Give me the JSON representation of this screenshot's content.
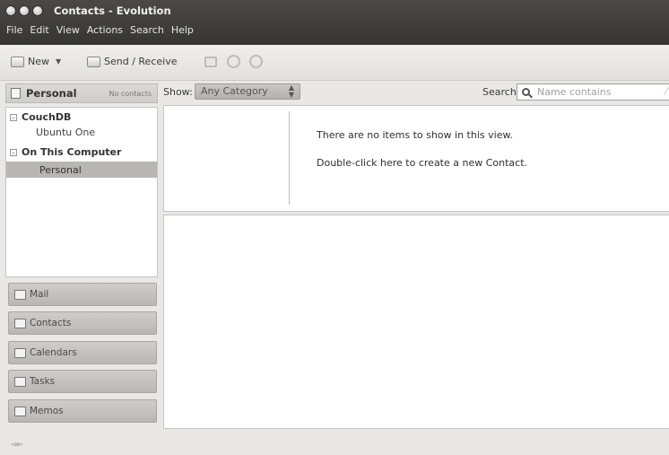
{
  "window": {
    "title": "Contacts - Evolution"
  },
  "menubar": [
    "File",
    "Edit",
    "View",
    "Actions",
    "Search",
    "Help"
  ],
  "toolbar": {
    "new_label": "New",
    "send_receive_label": "Send / Receive"
  },
  "sidebar": {
    "header_title": "Personal",
    "header_count": "No contacts",
    "groups": [
      {
        "label": "CouchDB",
        "children": [
          "Ubuntu One"
        ]
      },
      {
        "label": "On This Computer",
        "children": [
          "Personal"
        ]
      }
    ],
    "selected": "Personal",
    "switcher": [
      "Mail",
      "Contacts",
      "Calendars",
      "Tasks",
      "Memos"
    ]
  },
  "filter": {
    "show_label": "Show:",
    "category_value": "Any Category",
    "search_label": "Search:",
    "search_placeholder": "Name contains"
  },
  "list": {
    "empty_line1": "There are no items to show in this view.",
    "empty_line2": "Double-click here to create a new Contact."
  }
}
